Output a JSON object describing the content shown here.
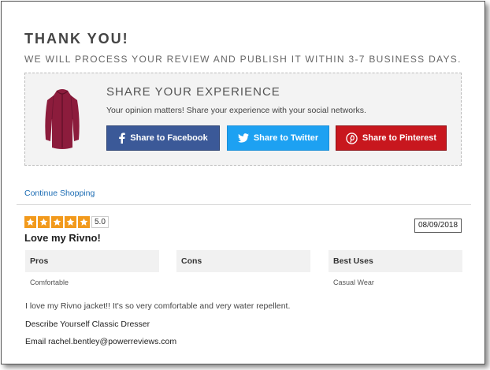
{
  "confirmation": {
    "title": "THANK YOU!",
    "subtitle": "WE WILL PROCESS YOUR REVIEW AND PUBLISH IT WITHIN 3-7 BUSINESS DAYS."
  },
  "share": {
    "title": "SHARE YOUR EXPERIENCE",
    "description": "Your opinion matters! Share your experience with your social networks.",
    "facebook_label": "Share to Facebook",
    "twitter_label": "Share to Twitter",
    "pinterest_label": "Share to Pinterest",
    "product_image_alt": "red jacket"
  },
  "nav": {
    "continue_label": "Continue Shopping"
  },
  "review": {
    "rating": 5,
    "rating_label": "5.0",
    "date": "08/09/2018",
    "headline": "Love my Rivno!",
    "attributes": [
      {
        "label": "Pros",
        "value": "Comfortable"
      },
      {
        "label": "Cons",
        "value": ""
      },
      {
        "label": "Best Uses",
        "value": "Casual Wear"
      }
    ],
    "body": "I love my Rivno jacket!! It's so very comfortable and very water repellent.",
    "describe_yourself": "Describe Yourself Classic Dresser",
    "email": "Email rachel.bentley@powerreviews.com"
  },
  "colors": {
    "facebook": "#3b5998",
    "twitter": "#1da1f2",
    "pinterest": "#c8171e",
    "star": "#f29a1c",
    "link": "#1a6bb3"
  },
  "icons": {
    "facebook": "facebook-icon",
    "twitter": "twitter-icon",
    "pinterest": "pinterest-icon",
    "star": "star-icon"
  }
}
